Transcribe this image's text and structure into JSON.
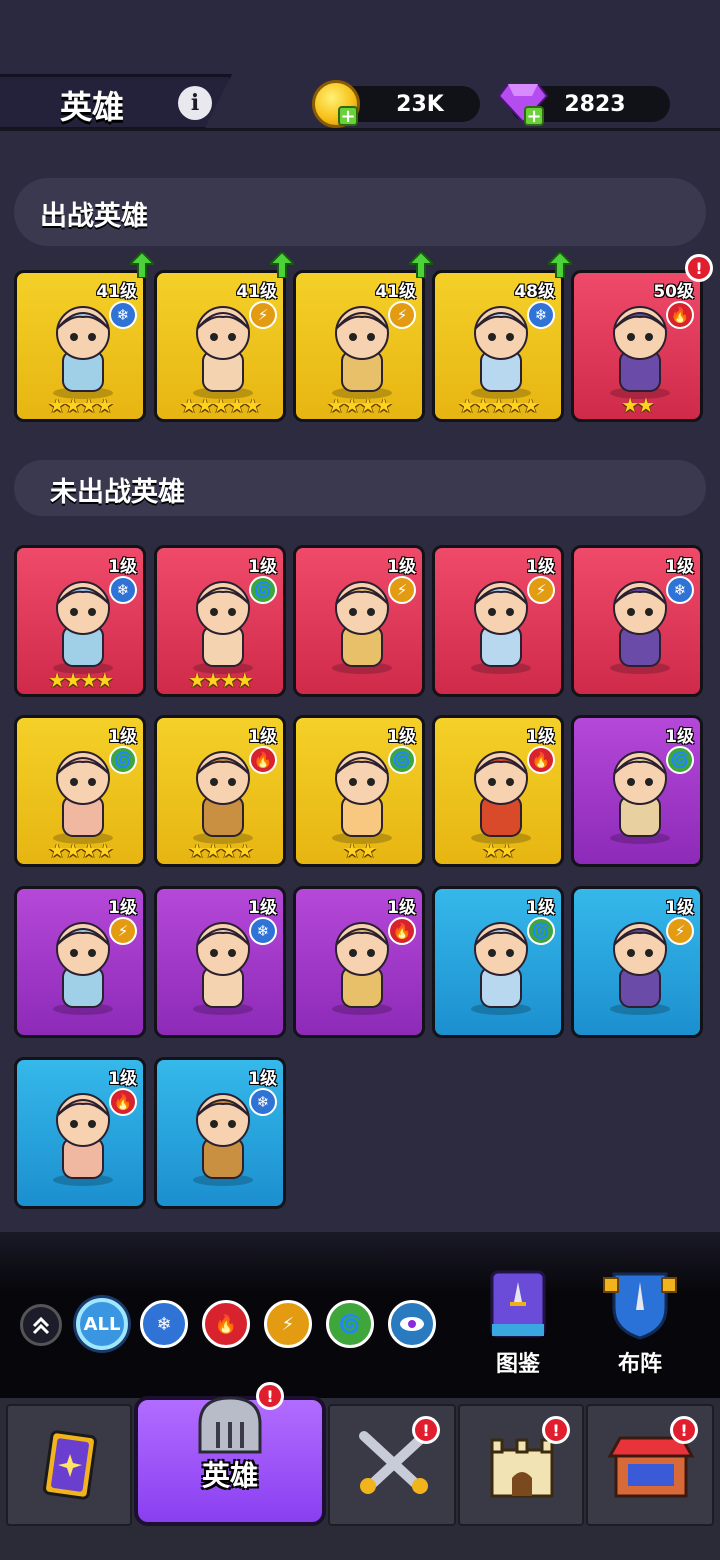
{
  "header": {
    "title": "英雄",
    "gold": "23K",
    "gems": "2823"
  },
  "sections": {
    "deployed_title": "出战英雄",
    "undeployed_title": "未出战英雄"
  },
  "colors": {
    "yellow": "#f4d028",
    "red": "#ef4a6a",
    "purple": "#b548d8",
    "blue": "#35b8ea"
  },
  "deployed_heroes": [
    {
      "level": "41级",
      "element": "ice",
      "stars": "★★★★",
      "rarity": "yellow",
      "upgrade": true,
      "alert": false
    },
    {
      "level": "41级",
      "element": "lightning",
      "stars": "★★★★★",
      "rarity": "yellow",
      "upgrade": true,
      "alert": false
    },
    {
      "level": "41级",
      "element": "lightning",
      "stars": "★★★★",
      "rarity": "yellow",
      "upgrade": true,
      "alert": false
    },
    {
      "level": "48级",
      "element": "ice",
      "stars": "★★★★★",
      "rarity": "yellow",
      "upgrade": true,
      "alert": false
    },
    {
      "level": "50级",
      "element": "fire",
      "stars": "★★",
      "rarity": "red",
      "upgrade": false,
      "alert": true
    }
  ],
  "undeployed_heroes": [
    {
      "level": "1级",
      "element": "ice",
      "stars": "★★★★",
      "rarity": "red"
    },
    {
      "level": "1级",
      "element": "wind",
      "stars": "★★★★",
      "rarity": "red"
    },
    {
      "level": "1级",
      "element": "lightning",
      "stars": "",
      "rarity": "red"
    },
    {
      "level": "1级",
      "element": "lightning",
      "stars": "",
      "rarity": "red"
    },
    {
      "level": "1级",
      "element": "ice",
      "stars": "",
      "rarity": "red"
    },
    {
      "level": "1级",
      "element": "wind",
      "stars": "★★★★",
      "rarity": "yellow"
    },
    {
      "level": "1级",
      "element": "fire",
      "stars": "★★★★",
      "rarity": "yellow"
    },
    {
      "level": "1级",
      "element": "wind",
      "stars": "★★",
      "rarity": "yellow"
    },
    {
      "level": "1级",
      "element": "fire",
      "stars": "★★",
      "rarity": "yellow"
    },
    {
      "level": "1级",
      "element": "wind",
      "stars": "",
      "rarity": "purple"
    },
    {
      "level": "1级",
      "element": "lightning",
      "stars": "",
      "rarity": "purple"
    },
    {
      "level": "1级",
      "element": "ice",
      "stars": "",
      "rarity": "purple"
    },
    {
      "level": "1级",
      "element": "fire",
      "stars": "",
      "rarity": "purple"
    },
    {
      "level": "1级",
      "element": "wind",
      "stars": "",
      "rarity": "blue"
    },
    {
      "level": "1级",
      "element": "lightning",
      "stars": "",
      "rarity": "blue"
    },
    {
      "level": "1级",
      "element": "fire",
      "stars": "",
      "rarity": "blue"
    },
    {
      "level": "1级",
      "element": "ice",
      "stars": "",
      "rarity": "blue"
    }
  ],
  "filters": {
    "collapse_icon": "double-chevron-up-icon",
    "all_label": "ALL",
    "element_icons": [
      "ice-icon",
      "fire-icon",
      "lightning-icon",
      "wind-icon",
      "eye-icon"
    ]
  },
  "side_buttons": {
    "codex_label": "图鉴",
    "formation_label": "布阵"
  },
  "bottom_nav": {
    "heroes_label": "英雄"
  }
}
